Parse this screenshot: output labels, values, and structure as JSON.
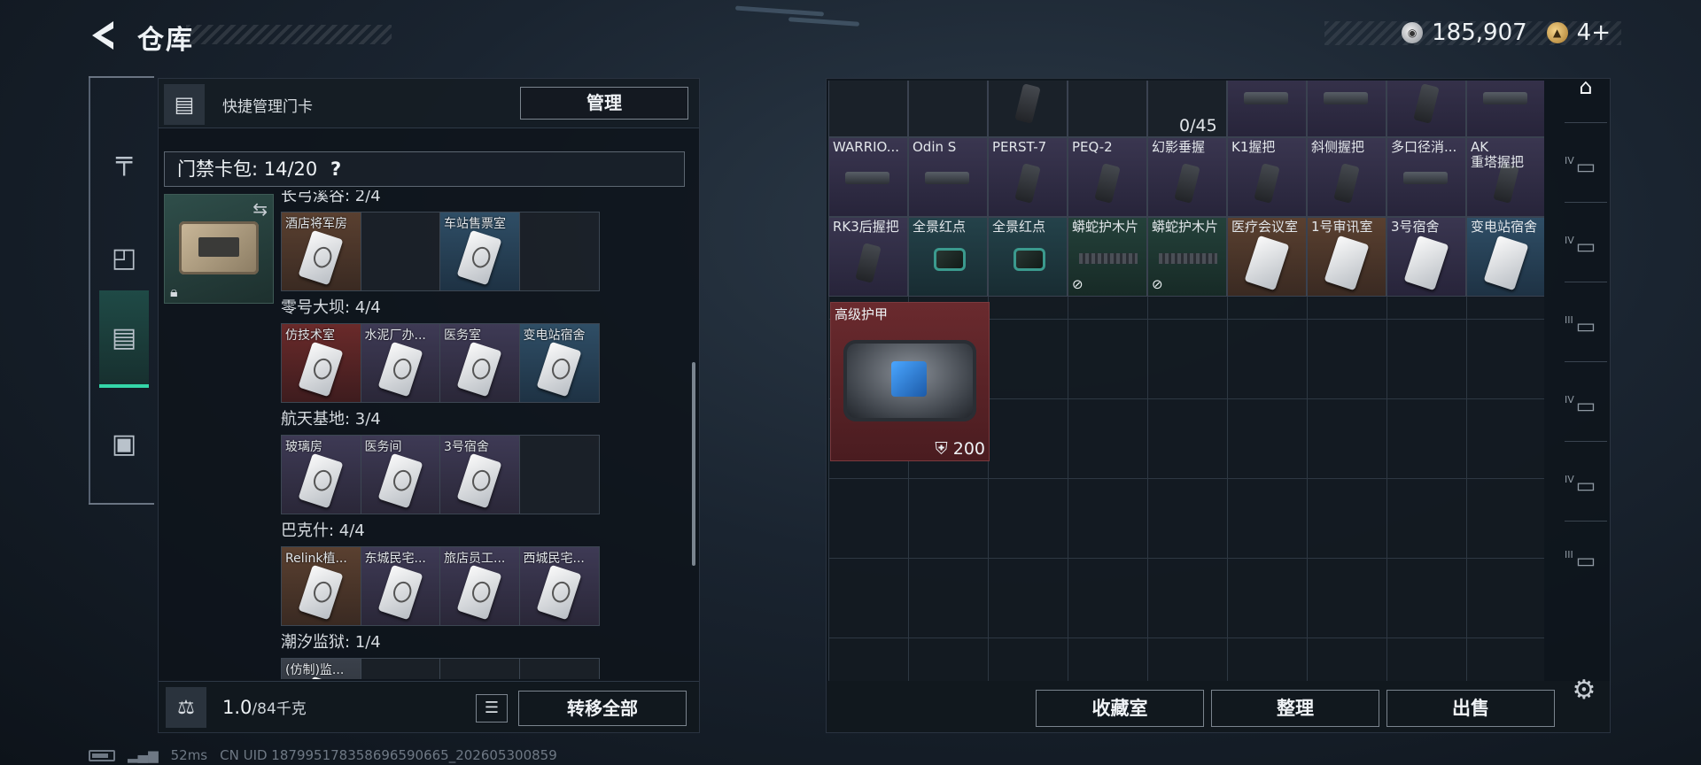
{
  "header": {
    "title": "仓库",
    "currency": [
      {
        "icon": "silver-coin-icon",
        "value": "185,907"
      },
      {
        "icon": "gold-coin-icon",
        "value": "4+"
      }
    ]
  },
  "left_rail": {
    "tabs": [
      {
        "icon": "gun-icon",
        "label": "Weapons"
      },
      {
        "icon": "backpack-icon",
        "label": "Gear"
      },
      {
        "icon": "keycard-pack-icon",
        "label": "Keycards",
        "active": true
      },
      {
        "icon": "briefcase-icon",
        "label": "Cases"
      }
    ]
  },
  "left_panel": {
    "title": "快捷管理门卡",
    "manage_label": "管理",
    "card_pack_label": "门禁卡包: 14/20",
    "help_icon": "?",
    "groups": [
      {
        "name": "长弓溪谷: 2/4",
        "cards": [
          {
            "label": "酒店将军房",
            "color": "brown"
          },
          {
            "label": "",
            "color": "empty"
          },
          {
            "label": "车站售票室",
            "color": "blue"
          },
          {
            "label": "",
            "color": "empty"
          }
        ]
      },
      {
        "name": "零号大坝: 4/4",
        "cards": [
          {
            "label": "仿技术室",
            "color": "red"
          },
          {
            "label": "水泥厂办...",
            "color": "purple"
          },
          {
            "label": "医务室",
            "color": "purple"
          },
          {
            "label": "变电站宿舍",
            "color": "blue"
          }
        ]
      },
      {
        "name": "航天基地: 3/4",
        "cards": [
          {
            "label": "玻璃房",
            "color": "purple"
          },
          {
            "label": "医务间",
            "color": "purple"
          },
          {
            "label": "3号宿舍",
            "color": "purple"
          },
          {
            "label": "",
            "color": "empty"
          }
        ]
      },
      {
        "name": "巴克什: 4/4",
        "cards": [
          {
            "label": "Relink植...",
            "color": "brown"
          },
          {
            "label": "东城民宅...",
            "color": "purple"
          },
          {
            "label": "旅店员工...",
            "color": "purple"
          },
          {
            "label": "西城民宅...",
            "color": "purple"
          }
        ]
      },
      {
        "name": "潮汐监狱: 1/4",
        "cards": [
          {
            "label": "(仿制)监...",
            "color": "gray"
          },
          {
            "label": "",
            "color": "empty"
          },
          {
            "label": "",
            "color": "empty"
          },
          {
            "label": "",
            "color": "empty"
          }
        ]
      }
    ],
    "weight": "1.0",
    "weight_unit": "/84千克",
    "transfer_all_label": "转移全部"
  },
  "status_bar": {
    "ping": "52ms",
    "uid": "CN UID 1879951783586965906​65_202605300859"
  },
  "storage": {
    "capacity": "0/45",
    "top_row": [
      {
        "label": "",
        "color": "darkc",
        "art": "none"
      },
      {
        "label": "",
        "color": "darkc",
        "art": "none"
      },
      {
        "label": "",
        "color": "darkc",
        "art": "grip"
      },
      {
        "label": "",
        "color": "darkc",
        "art": "none"
      },
      {
        "label": "",
        "color": "darkc",
        "art": "none"
      },
      {
        "label": "",
        "color": "purple",
        "art": "gear"
      },
      {
        "label": "",
        "color": "purple",
        "art": "gear"
      },
      {
        "label": "",
        "color": "purple",
        "art": "grip"
      },
      {
        "label": "",
        "color": "purple",
        "art": "gear"
      }
    ],
    "row2": [
      {
        "label": "WARRIO...",
        "color": "purple",
        "art": "gear"
      },
      {
        "label": "Odin S",
        "color": "purple",
        "art": "gear"
      },
      {
        "label": "PERST-7",
        "color": "purple",
        "art": "grip"
      },
      {
        "label": "PEQ-2",
        "color": "purple",
        "art": "grip"
      },
      {
        "label": "幻影垂握",
        "color": "purple",
        "art": "grip"
      },
      {
        "label": "K1握把",
        "color": "purple",
        "art": "grip"
      },
      {
        "label": "斜侧握把",
        "color": "purple",
        "art": "grip"
      },
      {
        "label": "多口径消...",
        "color": "purple",
        "art": "gear"
      },
      {
        "label": "AK\n重塔握把",
        "color": "purple",
        "art": "grip"
      }
    ],
    "row3": [
      {
        "label": "RK3后握把",
        "color": "purple",
        "art": "grip"
      },
      {
        "label": "全景红点",
        "color": "teal",
        "art": "scope"
      },
      {
        "label": "全景红点",
        "color": "teal",
        "art": "scope"
      },
      {
        "label": "蟒蛇护木片",
        "color": "green",
        "art": "rail",
        "nosell": true
      },
      {
        "label": "蟒蛇护木片",
        "color": "green",
        "art": "rail",
        "nosell": true
      },
      {
        "label": "医疗会议室",
        "color": "brown",
        "art": "card"
      },
      {
        "label": "1号审讯室",
        "color": "brown",
        "art": "card"
      },
      {
        "label": "3号宿舍",
        "color": "purple",
        "art": "card"
      },
      {
        "label": "变电站宿舍",
        "color": "bluec",
        "art": "card"
      }
    ],
    "armor": {
      "label": "高级护甲",
      "durability": "200"
    }
  },
  "right_footer": {
    "collection_label": "收藏室",
    "sort_label": "整理",
    "sell_label": "出售"
  },
  "right_rail": {
    "items": [
      {
        "icon": "storage-home-icon",
        "tier": "",
        "active": true
      },
      {
        "icon": "folder-ammo-icon",
        "tier": "IV"
      },
      {
        "icon": "case-icon",
        "tier": "IV"
      },
      {
        "icon": "triangle-case-icon",
        "tier": "III"
      },
      {
        "icon": "medical-case-icon",
        "tier": "IV"
      },
      {
        "icon": "medical-case-plus-icon",
        "tier": "IV"
      },
      {
        "icon": "ammo-box-icon",
        "tier": "III"
      }
    ]
  },
  "colors": {
    "accent": "#34d6a8",
    "armor_red": "#6a2a2e",
    "purple_item": "#3a3650"
  }
}
